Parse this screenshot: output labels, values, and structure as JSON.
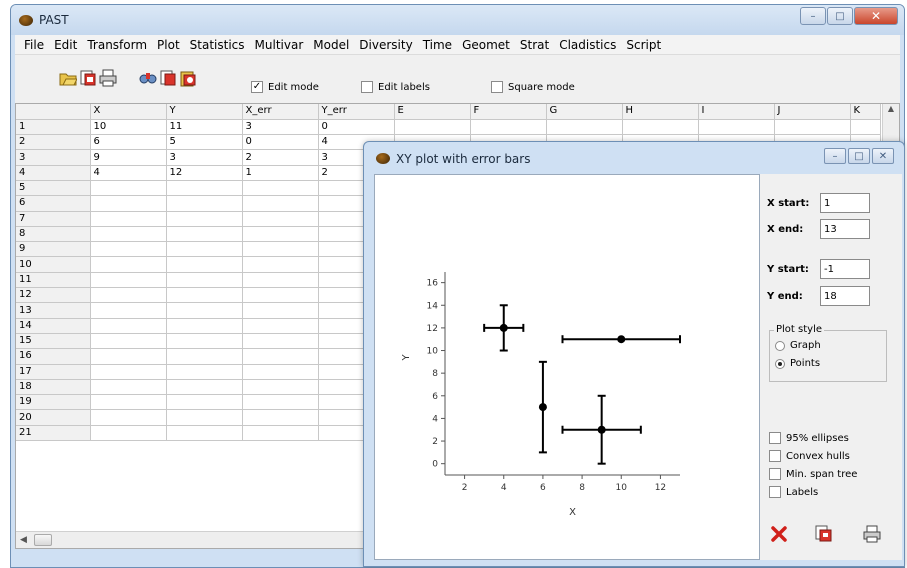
{
  "app": {
    "title": "PAST"
  },
  "menu": [
    "File",
    "Edit",
    "Transform",
    "Plot",
    "Statistics",
    "Multivar",
    "Model",
    "Diversity",
    "Time",
    "Geomet",
    "Strat",
    "Cladistics",
    "Script"
  ],
  "toolbar": {
    "edit_mode_label": "Edit mode",
    "edit_mode_checked": true,
    "edit_labels_label": "Edit labels",
    "edit_labels_checked": false,
    "square_mode_label": "Square mode",
    "square_mode_checked": false
  },
  "sheet": {
    "columns": [
      "X",
      "Y",
      "X_err",
      "Y_err",
      "E",
      "F",
      "G",
      "H",
      "I",
      "J",
      "K"
    ],
    "rows": [
      {
        "label": "1",
        "cells": [
          "10",
          "11",
          "3",
          "0"
        ]
      },
      {
        "label": "2",
        "cells": [
          "6",
          "5",
          "0",
          "4"
        ]
      },
      {
        "label": "3",
        "cells": [
          "9",
          "3",
          "2",
          "3"
        ]
      },
      {
        "label": "4",
        "cells": [
          "4",
          "12",
          "1",
          "2"
        ]
      },
      {
        "label": "5",
        "cells": []
      },
      {
        "label": "6",
        "cells": []
      },
      {
        "label": "7",
        "cells": []
      },
      {
        "label": "8",
        "cells": []
      },
      {
        "label": "9",
        "cells": []
      },
      {
        "label": "10",
        "cells": []
      },
      {
        "label": "11",
        "cells": []
      },
      {
        "label": "12",
        "cells": []
      },
      {
        "label": "13",
        "cells": []
      },
      {
        "label": "14",
        "cells": []
      },
      {
        "label": "15",
        "cells": []
      },
      {
        "label": "16",
        "cells": []
      },
      {
        "label": "17",
        "cells": []
      },
      {
        "label": "18",
        "cells": []
      },
      {
        "label": "19",
        "cells": []
      },
      {
        "label": "20",
        "cells": []
      },
      {
        "label": "21",
        "cells": []
      }
    ]
  },
  "plot_window": {
    "title": "XY plot with error bars",
    "x_start_label": "X start:",
    "x_start": "1",
    "x_end_label": "X end:",
    "x_end": "13",
    "y_start_label": "Y start:",
    "y_start": "-1",
    "y_end_label": "Y end:",
    "y_end": "18",
    "plot_style_label": "Plot style",
    "plot_style_options": [
      "Graph",
      "Points"
    ],
    "plot_style_selected": "Points",
    "options": [
      {
        "label": "95% ellipses",
        "checked": false
      },
      {
        "label": "Convex hulls",
        "checked": false
      },
      {
        "label": "Min. span tree",
        "checked": false
      },
      {
        "label": "Labels",
        "checked": false
      }
    ]
  },
  "chart_data": {
    "type": "scatter",
    "xlabel": "X",
    "ylabel": "Y",
    "xlim": [
      1,
      13
    ],
    "ylim": [
      -1,
      18
    ],
    "x_ticks": [
      2,
      4,
      6,
      8,
      10,
      12
    ],
    "y_ticks": [
      0,
      2,
      4,
      6,
      8,
      10,
      12,
      14,
      16
    ],
    "points": [
      {
        "x": 10,
        "y": 11,
        "x_err": 3,
        "y_err": 0
      },
      {
        "x": 6,
        "y": 5,
        "x_err": 0,
        "y_err": 4
      },
      {
        "x": 9,
        "y": 3,
        "x_err": 2,
        "y_err": 3
      },
      {
        "x": 4,
        "y": 12,
        "x_err": 1,
        "y_err": 2
      }
    ]
  },
  "colors": {
    "title_bar": "#cfe0f3",
    "close_button": "#c9462c",
    "points": "#000000"
  },
  "icons": [
    "open-icon",
    "save-icon",
    "print-icon",
    "find-icon",
    "copy-icon",
    "clipboard-icon",
    "close-x-icon",
    "copy-graph-icon",
    "print-graph-icon"
  ]
}
